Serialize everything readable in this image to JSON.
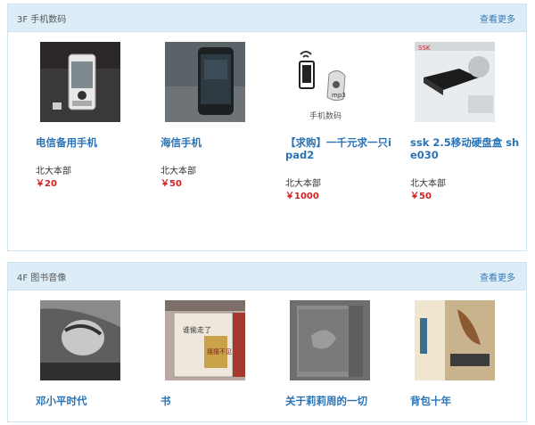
{
  "floors": [
    {
      "title": "3F 手机数码",
      "more": "查看更多",
      "items": [
        {
          "title": "电信备用手机",
          "location": "北大本部",
          "price": "￥20"
        },
        {
          "title": "海信手机",
          "location": "北大本部",
          "price": "￥50"
        },
        {
          "title": "【求购】一千元求一只ipad2",
          "location": "北大本部",
          "price": "￥1000",
          "image_caption": "手机数码"
        },
        {
          "title": "ssk 2.5移动硬盘盒 she030",
          "location": "北大本部",
          "price": "￥50",
          "image_text": "SSK"
        }
      ]
    },
    {
      "title": "4F 图书音像",
      "more": "查看更多",
      "items": [
        {
          "title": "邓小平时代"
        },
        {
          "title": "书",
          "image_text_1": "谁偷走了",
          "image_text_2": "猜猜不见"
        },
        {
          "title": "关于莉莉周的一切"
        },
        {
          "title": "背包十年"
        }
      ]
    }
  ],
  "colors": {
    "link": "#2b73b5",
    "price": "#d32222",
    "header_bg": "#dcedf7",
    "border": "#cfe2ee"
  }
}
